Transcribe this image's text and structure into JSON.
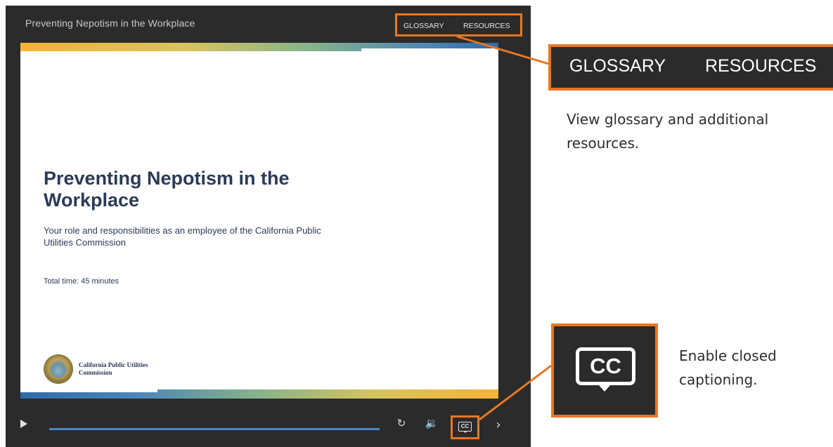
{
  "player": {
    "title": "Preventing Nepotism in the Workplace",
    "nav": {
      "glossary": "GLOSSARY",
      "resources": "RESOURCES"
    }
  },
  "slide": {
    "title": "Preventing Nepotism in the Workplace",
    "subtitle": "Your role and responsibilities as an employee of the California Public Utilities Commission",
    "total_time": "Total time: 45 minutes",
    "org_name": "California Public Utilities Commission"
  },
  "controls": {
    "play_icon": "play-icon",
    "replay_icon": "replay-icon",
    "volume_icon": "volume-icon",
    "cc_label": "CC",
    "next_icon": "chevron-right-icon",
    "replay_glyph": "↻",
    "volume_glyph": "🔉",
    "next_glyph": "›"
  },
  "callouts": {
    "nav": {
      "glossary": "GLOSSARY",
      "resources": "RESOURCES",
      "description": "View glossary and additional resources."
    },
    "cc": {
      "label": "CC",
      "description": "Enable closed captioning."
    }
  },
  "colors": {
    "accent": "#e87722",
    "player_bg": "#2b2b2b",
    "slide_text": "#2b3a57",
    "progress": "#4d86c9"
  }
}
